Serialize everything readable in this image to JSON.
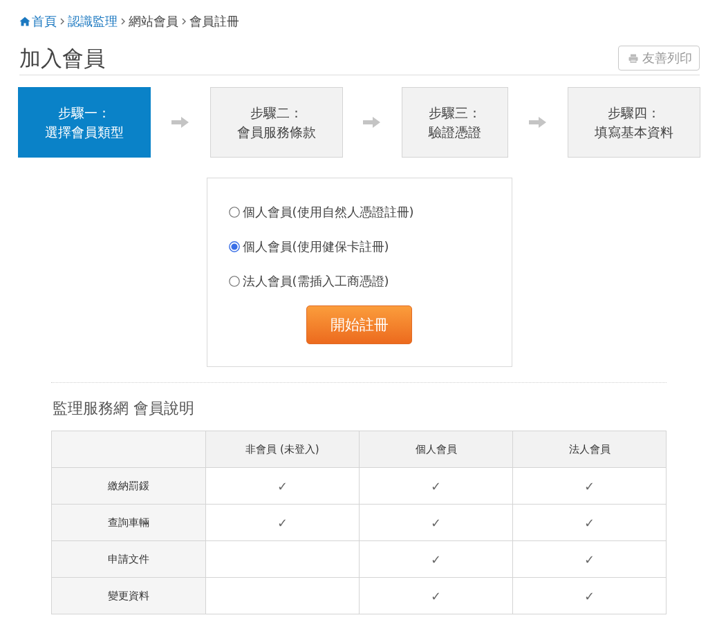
{
  "breadcrumb": [
    {
      "label": "首頁",
      "kind": "home"
    },
    {
      "label": "認識監理",
      "kind": "link"
    },
    {
      "label": "網站會員",
      "kind": "text"
    },
    {
      "label": "會員註冊",
      "kind": "text"
    }
  ],
  "page_title": "加入會員",
  "print_button": "友善列印",
  "steps": [
    {
      "label": "步驟一：",
      "title": "選擇會員類型",
      "selected": true
    },
    {
      "label": "步驟二：",
      "title": "會員服務條款",
      "selected": false
    },
    {
      "label": "步驟三：",
      "title": "驗證憑證",
      "selected": false
    },
    {
      "label": "步驟四：",
      "title": "填寫基本資料",
      "selected": false
    }
  ],
  "member_types": [
    {
      "label": "個人會員(使用自然人憑證註冊)",
      "selected": false
    },
    {
      "label": "個人會員(使用健保卡註冊)",
      "selected": true
    },
    {
      "label": "法人會員(需插入工商憑證)",
      "selected": false
    }
  ],
  "start_button": "開始註冊",
  "comparison": {
    "title": "監理服務網 會員說明",
    "columns": [
      "非會員 (未登入)",
      "個人會員",
      "法人會員"
    ],
    "rows": [
      {
        "label": "繳納罰鍰",
        "cells": [
          "✓",
          "✓",
          "✓"
        ]
      },
      {
        "label": "查詢車輛",
        "cells": [
          "✓",
          "✓",
          "✓"
        ]
      },
      {
        "label": "申請文件",
        "cells": [
          null,
          "✓",
          "✓"
        ]
      },
      {
        "label": "變更資料",
        "cells": [
          null,
          "✓",
          "✓"
        ]
      }
    ]
  }
}
